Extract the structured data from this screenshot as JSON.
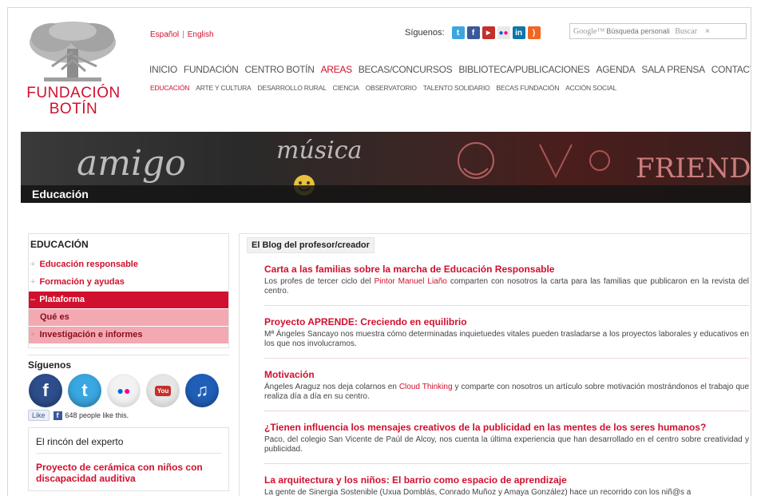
{
  "header": {
    "logo_line1": "FUNDACIÓN",
    "logo_line2": "BOTÍN",
    "lang_es": "Español",
    "lang_sep": "|",
    "lang_en": "English",
    "follow_label": "Síguenos:",
    "search_brand": "Google™",
    "search_placeholder": "Búsqueda personalizada",
    "search_button": "Buscar",
    "search_clear": "×",
    "social_icons": [
      "twitter-icon",
      "facebook-icon",
      "youtube-icon",
      "flickr-icon",
      "linkedin-icon",
      "rss-icon"
    ]
  },
  "mainnav": [
    "INICIO",
    "FUNDACIÓN",
    "CENTRO BOTÍN",
    "AREAS",
    "BECAS/CONCURSOS",
    "BIBLIOTECA/PUBLICACIONES",
    "AGENDA",
    "SALA PRENSA",
    "CONTACTO"
  ],
  "mainnav_active": "AREAS",
  "subnav": [
    "EDUCACIÓN",
    "ARTE Y CULTURA",
    "DESARROLLO RURAL",
    "CIENCIA",
    "OBSERVATORIO",
    "TALENTO SOLIDARIO",
    "BECAS FUNDACIÓN",
    "ACCIÓN SOCIAL"
  ],
  "subnav_active": "EDUCACIÓN",
  "banner": {
    "title": "Educación",
    "words": [
      "amigo",
      "música",
      "FRIENDS"
    ]
  },
  "sidebar": {
    "heading": "EDUCACIÓN",
    "items": [
      {
        "label": "Educación responsable",
        "prefix": "+"
      },
      {
        "label": "Formación y ayudas",
        "prefix": "+"
      },
      {
        "label": "Plataforma",
        "prefix": "–"
      },
      {
        "label": "Qué es",
        "prefix": ""
      },
      {
        "label": "Investigación e informes",
        "prefix": "+"
      }
    ],
    "follow_heading": "Síguenos",
    "social": [
      "facebook-icon",
      "twitter-icon",
      "flickr-icon",
      "youtube-icon",
      "music-icon"
    ],
    "like_label": "Like",
    "like_count": "648 people like this.",
    "expert_heading": "El rincón del experto",
    "expert_link": "Proyecto de cerámica con niños con discapacidad auditiva"
  },
  "blog": {
    "heading": "El Blog del profesor/creador",
    "posts": [
      {
        "title": "Carta a las familias sobre la marcha de Educación Responsable",
        "text_a": "Los profes de tercer ciclo del ",
        "link": "Pintor Manuel Liaño",
        "text_b": " comparten con nosotros la carta para las familias que publicaron en la revista del centro."
      },
      {
        "title": "Proyecto APRENDE: Creciendo en equilibrio",
        "text_a": "Mª Ángeles Sancayo nos muestra cómo determinadas inquietuedes vitales pueden trasladarse a los proyectos laborales y educativos en los que nos involucramos.",
        "link": "",
        "text_b": ""
      },
      {
        "title": "Motivación",
        "text_a": "Ángeles Araguz nos deja colarnos en ",
        "link": "Cloud Thinking",
        "text_b": " y comparte con nosotros un artículo sobre motivación mostrándonos el trabajo que realiza día a día en su centro."
      },
      {
        "title": "¿Tienen influencia los mensajes creativos de la publicidad en las mentes de los seres humanos?",
        "text_a": "Paco, del colegio San Vicente de Paúl de Alcoy, nos cuenta la última experiencia que han desarrollado en el centro sobre creatividad y publicidad.",
        "link": "",
        "text_b": ""
      },
      {
        "title": "La arquitectura y los niños: El barrio como espacio de aprendizaje",
        "text_a": "La gente de Sinergia Sostenible (Uxua Domblás, Conrado Muñoz y Amaya González) hace un recorrido con los niñ@s a",
        "link": "",
        "text_b": ""
      }
    ]
  },
  "colors": {
    "brand_red": "#d0102e",
    "pink": "#f3a9b2",
    "facebook": "#3b5998",
    "twitter": "#3aa7e0"
  }
}
